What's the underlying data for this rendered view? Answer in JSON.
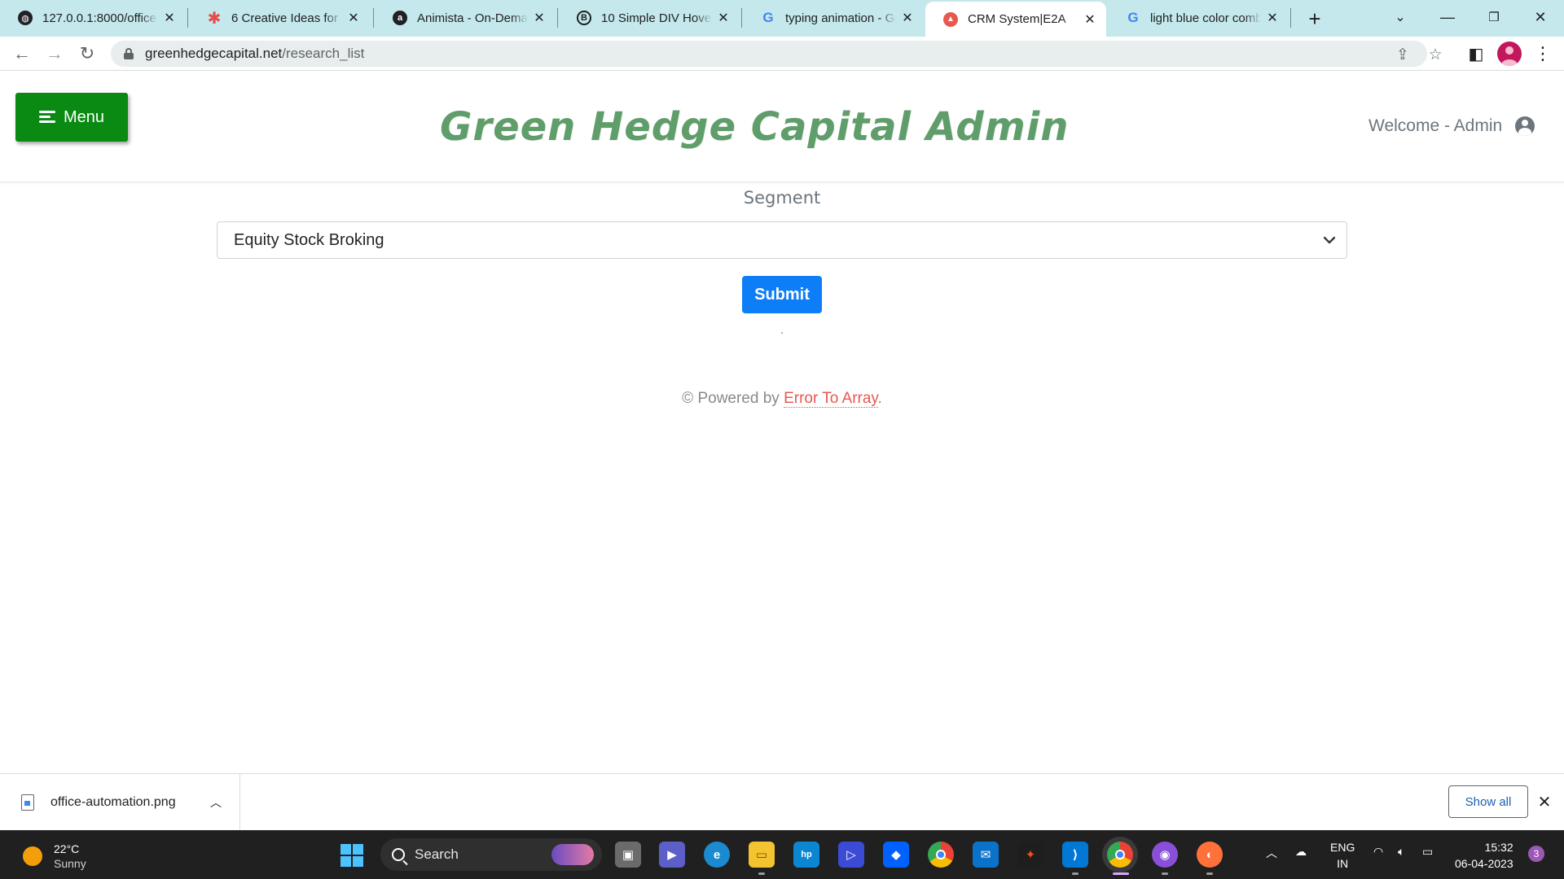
{
  "browser": {
    "tabs": [
      {
        "title": "127.0.0.1:8000/office-",
        "icon": "globe-icon",
        "color": "#202124"
      },
      {
        "title": "6 Creative Ideas for C",
        "icon": "asterisk-icon",
        "color": "#e24c4b"
      },
      {
        "title": "Animista - On-Deman",
        "icon": "animista-icon",
        "color": "#202124"
      },
      {
        "title": "10 Simple DIV Hover E",
        "icon": "bootstrap-icon",
        "color": "#202124"
      },
      {
        "title": "typing animation - Go",
        "icon": "google-icon",
        "color": "#4285f4"
      },
      {
        "title": "CRM System|E2A",
        "icon": "e2a-icon",
        "color": "#e8584f"
      },
      {
        "title": "light blue color comb",
        "icon": "google-icon",
        "color": "#4285f4"
      }
    ],
    "active_tab": 5,
    "url_host": "greenhedgecapital.net",
    "url_path": "/research_list"
  },
  "page": {
    "menu_label": "Menu",
    "brand_title": "Green Hedge Capital Admin",
    "welcome_text": "Welcome - Admin",
    "segment_label": "Segment",
    "segment_selected": "Equity Stock Broking",
    "submit_label": "Submit",
    "footer_prefix": "© Powered by ",
    "footer_link": "Error To Array",
    "footer_suffix": "."
  },
  "downloads": {
    "file_name": "office-automation.png",
    "show_all_label": "Show all"
  },
  "taskbar": {
    "temperature": "22°C",
    "weather": "Sunny",
    "search_label": "Search",
    "lang_primary": "ENG",
    "lang_secondary": "IN",
    "time": "15:32",
    "date": "06-04-2023",
    "notification_count": "3"
  },
  "colors": {
    "tabstrip": "#c4e8ec",
    "menu_button": "#0a8a12",
    "brand": "#5f9e6a",
    "submit_button": "#0d7ef8",
    "footer_link": "#e8584f"
  }
}
